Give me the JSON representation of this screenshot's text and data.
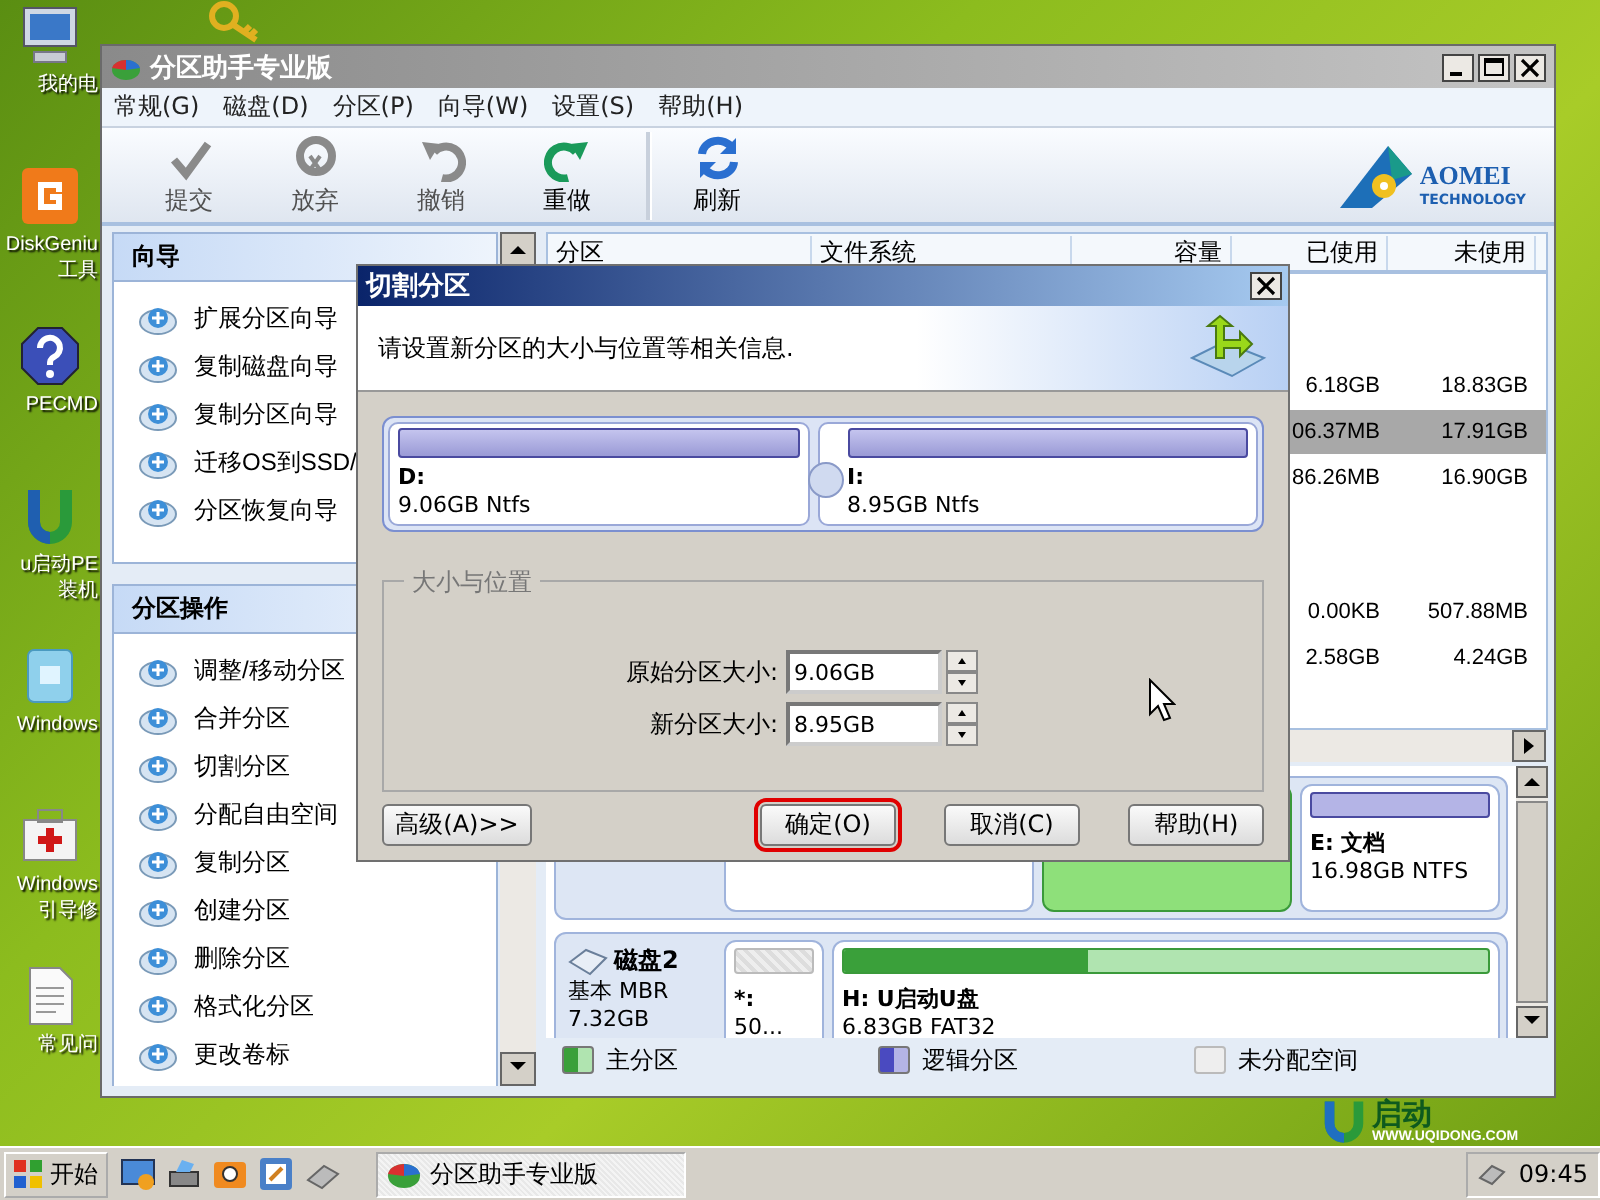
{
  "desktop": {
    "icons": [
      {
        "kind": "computer",
        "lines": [
          "我的电"
        ]
      },
      {
        "kind": "diskgenius",
        "lines": [
          "DiskGeniu",
          "工具"
        ]
      },
      {
        "kind": "help",
        "lines": [
          "PECMD"
        ]
      },
      {
        "kind": "u-logo",
        "lines": [
          "u启动PE",
          "装机"
        ]
      },
      {
        "kind": "windows",
        "lines": [
          "Windows"
        ]
      },
      {
        "kind": "toolbox",
        "lines": [
          "Windows",
          "引导修"
        ]
      },
      {
        "kind": "document",
        "lines": [
          "常见问"
        ]
      }
    ],
    "logo": {
      "brand": "启动",
      "url": "WWW.UQIDONG.COM"
    }
  },
  "window": {
    "title": "分区助手专业版",
    "menu": [
      "常规(G)",
      "磁盘(D)",
      "分区(P)",
      "向导(W)",
      "设置(S)",
      "帮助(H)"
    ],
    "toolbar": [
      {
        "kind": "commit",
        "label": "提交",
        "disabled": true,
        "group_start": false
      },
      {
        "kind": "discard",
        "label": "放弃",
        "disabled": true,
        "group_start": false
      },
      {
        "kind": "undo",
        "label": "撤销",
        "disabled": true,
        "group_start": false
      },
      {
        "kind": "redo",
        "label": "重做",
        "disabled": false,
        "group_start": false
      },
      {
        "kind": "refresh",
        "label": "刷新",
        "disabled": false,
        "group_start": true
      }
    ],
    "logo": {
      "name": "AOMEI",
      "tagline": "TECHNOLOGY"
    }
  },
  "sidebar": {
    "sections": [
      {
        "title": "向导",
        "items": [
          "扩展分区向导",
          "复制磁盘向导",
          "复制分区向导",
          "迁移OS到SSD/",
          "分区恢复向导"
        ]
      },
      {
        "title": "分区操作",
        "items": [
          "调整/移动分区",
          "合并分区",
          "切割分区",
          "分配自由空间",
          "复制分区",
          "创建分区",
          "删除分区",
          "格式化分区",
          "更改卷标"
        ]
      }
    ]
  },
  "table": {
    "columns": [
      "分区",
      "文件系统",
      "容量",
      "已使用",
      "未使用"
    ],
    "rows": [
      {
        "kind": "blank"
      },
      {
        "kind": "blank"
      },
      {
        "kind": "partition",
        "used": "6.18GB",
        "free": "18.83GB",
        "selected": false
      },
      {
        "kind": "partition",
        "used": "06.37MB",
        "free": "17.91GB",
        "selected": true
      },
      {
        "kind": "partition",
        "used": "86.26MB",
        "free": "16.90GB",
        "selected": false
      },
      {
        "kind": "blank"
      },
      {
        "kind": "blank"
      },
      {
        "kind": "partition",
        "used": "0.00KB",
        "free": "507.88MB",
        "selected": false
      },
      {
        "kind": "partition",
        "used": "2.58GB",
        "free": "4.24GB",
        "selected": false
      }
    ]
  },
  "disk_map": {
    "disks": [
      {
        "partitions": [
          {
            "kind": "logical",
            "selected": false
          },
          {
            "kind": "primary",
            "selected": true
          },
          {
            "kind": "logical",
            "selected": false,
            "label": "E: 文档",
            "detail": "16.98GB NTFS"
          }
        ]
      },
      {
        "name": "磁盘2",
        "type": "基本 MBR",
        "size": "7.32GB",
        "partitions": [
          {
            "kind": "unallocated",
            "selected": false,
            "label": "*:",
            "detail": "50..."
          },
          {
            "kind": "primary",
            "selected": false,
            "label": "H: U启动U盘",
            "detail": "6.83GB FAT32",
            "level": 0.38
          }
        ]
      }
    ]
  },
  "legend": [
    {
      "kind": "primary",
      "label": "主分区"
    },
    {
      "kind": "logical",
      "label": "逻辑分区"
    },
    {
      "kind": "unallocated",
      "label": "未分配空间"
    }
  ],
  "dialog": {
    "title": "切割分区",
    "instruction": "请设置新分区的大小与位置等相关信息.",
    "partitions": [
      {
        "label": "D:",
        "detail": "9.06GB Ntfs"
      },
      {
        "label": "I:",
        "detail": "8.95GB Ntfs"
      }
    ],
    "divider": {
      "level": 0.5
    },
    "group_title": "大小与位置",
    "fields": [
      {
        "label": "原始分区大小:",
        "value": "9.06GB"
      },
      {
        "label": "新分区大小:",
        "value": "8.95GB"
      }
    ],
    "buttons": [
      {
        "kind": "advanced",
        "label": "高级(A)>>",
        "highlighted": false
      },
      {
        "kind": "ok",
        "label": "确定(O)",
        "highlighted": true
      },
      {
        "kind": "cancel",
        "label": "取消(C)",
        "highlighted": false
      },
      {
        "kind": "help",
        "label": "帮助(H)",
        "highlighted": false
      }
    ]
  },
  "taskbar": {
    "start": "开始",
    "tasks": [
      "分区助手专业版"
    ],
    "clock": "09:45"
  }
}
